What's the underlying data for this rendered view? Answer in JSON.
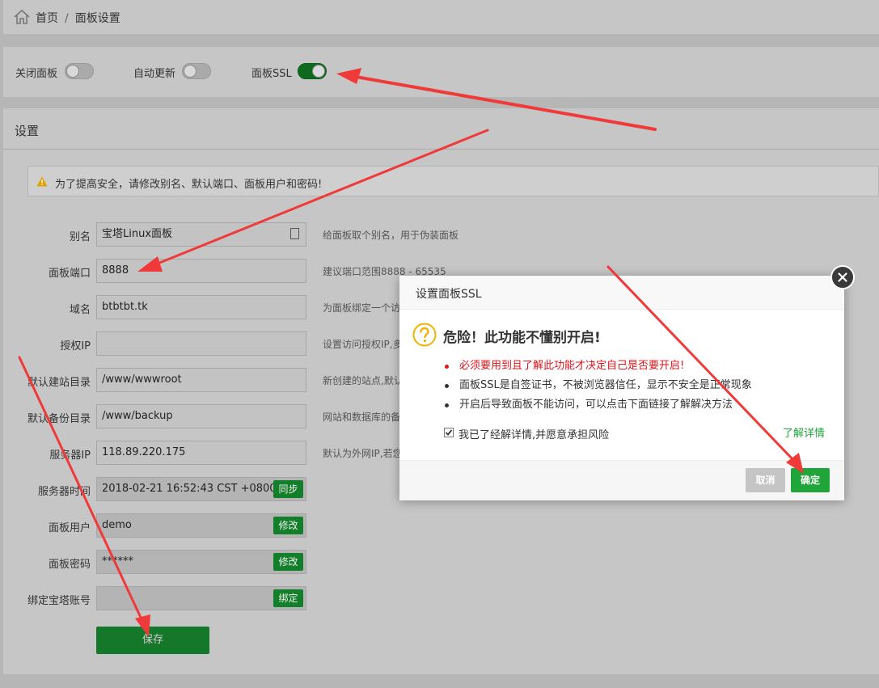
{
  "breadcrumb": {
    "home": "首页",
    "separator": "/",
    "current": "面板设置"
  },
  "toggles": [
    {
      "label": "关闭面板",
      "state": "off"
    },
    {
      "label": "自动更新",
      "state": "off"
    },
    {
      "label": "面板SSL",
      "state": "on"
    }
  ],
  "settings": {
    "title": "设置",
    "notice": "为了提高安全，请修改别名、默认端口、面板用户和密码!",
    "fields": [
      {
        "label": "别名",
        "value": "宝塔Linux面板",
        "hint": "给面板取个别名，用于伪装面板"
      },
      {
        "label": "面板端口",
        "value": "8888",
        "hint": "建议端口范围8888 - 65535"
      },
      {
        "label": "域名",
        "value": "btbtbt.tk",
        "hint": "为面板绑定一个访"
      },
      {
        "label": "授权IP",
        "value": "",
        "hint": "设置访问授权IP,多"
      },
      {
        "label": "默认建站目录",
        "value": "/www/wwwroot",
        "hint": "新创建的站点,默认"
      },
      {
        "label": "默认备份目录",
        "value": "/www/backup",
        "hint": "网站和数据库的备"
      },
      {
        "label": "服务器IP",
        "value": "118.89.220.175",
        "hint": "默认为外网IP,若您"
      },
      {
        "label": "服务器时间",
        "value": "2018-02-21 16:52:43 CST +0800",
        "button": "同步"
      },
      {
        "label": "面板用户",
        "value": "demo",
        "button": "修改"
      },
      {
        "label": "面板密码",
        "value": "******",
        "button": "修改"
      },
      {
        "label": "绑定宝塔账号",
        "value": "",
        "button": "绑定"
      }
    ],
    "save_label": "保存"
  },
  "modal": {
    "title": "设置面板SSL",
    "heading": "危险！此功能不懂别开启!",
    "items": [
      "必须要用到且了解此功能才决定自己是否要开启!",
      "面板SSL是自签证书，不被浏览器信任，显示不安全是正常现象",
      "开启后导致面板不能访问，可以点击下面链接了解解决方法"
    ],
    "checkbox_label": "我已了经解详情,并愿意承担风险",
    "checkbox_checked": true,
    "learn_more": "了解详情",
    "cancel_label": "取消",
    "confirm_label": "确定"
  },
  "colors": {
    "accent": "#20a53a",
    "danger": "#e3141b",
    "arrow": "#f03a3a",
    "overlay": "#b6b6b6"
  }
}
